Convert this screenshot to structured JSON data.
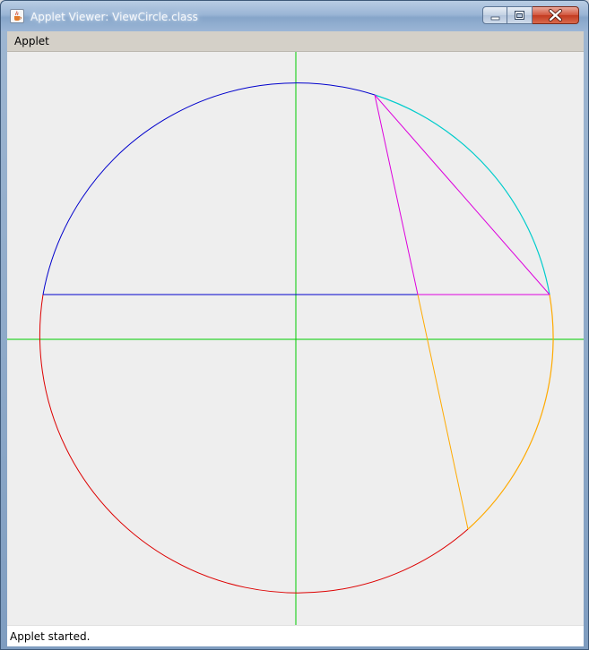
{
  "window": {
    "title": "Applet Viewer: ViewCircle.class",
    "icons": {
      "app": "java-cup-icon",
      "minimize": "minimize-icon",
      "maximize": "maximize-icon",
      "close": "close-icon"
    }
  },
  "menubar": {
    "items": [
      {
        "label": "Applet"
      }
    ]
  },
  "status": {
    "text": "Applet started."
  },
  "drawing": {
    "colors": {
      "axes": "#00cc00",
      "upper_arc": "#0000cc",
      "lower_arc": "#dd0000",
      "chord_horizontal": "#0000cc",
      "triangle": "#dd00dd",
      "right_arc_upper": "#00cccc",
      "right_arc_lower": "#ffaa00",
      "long_chord": "#ffaa00",
      "background": "#eeeeee"
    }
  }
}
